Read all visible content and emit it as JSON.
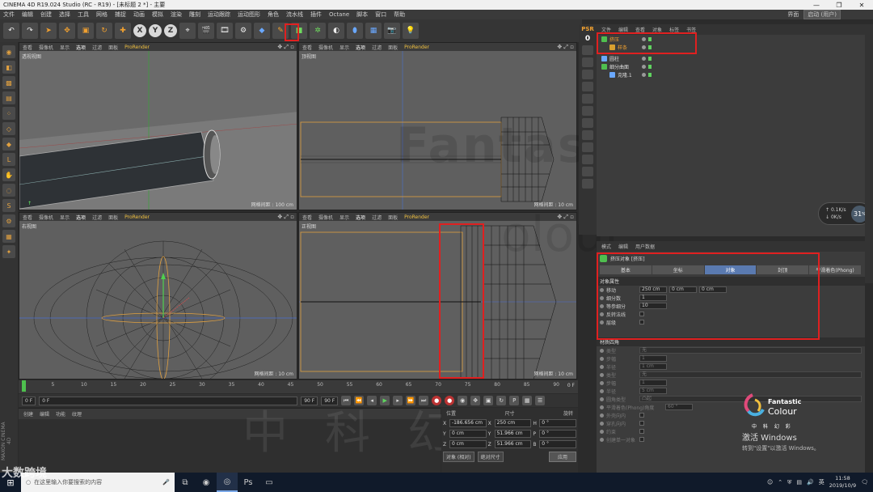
{
  "window": {
    "title": "CINEMA 4D R19.024 Studio (RC - R19) - [未标题 2 *] - 主要",
    "controls": [
      "—",
      "❐",
      "✕"
    ]
  },
  "menu": {
    "items": [
      "文件",
      "编辑",
      "创建",
      "选择",
      "工具",
      "网格",
      "捕捉",
      "动画",
      "模拟",
      "渲染",
      "雕刻",
      "运动跟踪",
      "运动图形",
      "角色",
      "流水线",
      "插件",
      "Octane",
      "脚本",
      "窗口",
      "帮助"
    ],
    "layout_label": "界面",
    "layout_value": "启动 (用户)"
  },
  "toolbar": {
    "axis_x": "X",
    "axis_y": "Y",
    "axis_z": "Z"
  },
  "viewports": {
    "menu": [
      "查看",
      "摄像机",
      "显示",
      "选项",
      "过滤",
      "面板"
    ],
    "prorender": "ProRender",
    "perspective": {
      "label": "透视视图",
      "grid": "网格间距 : 100 cm"
    },
    "top": {
      "label": "顶视图",
      "grid": "网格间距 : 10 cm"
    },
    "right": {
      "label": "右视图",
      "grid": "网格间距 : 10 cm"
    },
    "front": {
      "label": "正视图",
      "grid": "网格间距 : 10 cm"
    }
  },
  "timeline": {
    "ticks": [
      "0",
      "5",
      "10",
      "15",
      "20",
      "25",
      "30",
      "35",
      "40",
      "45",
      "50",
      "55",
      "60",
      "65",
      "70",
      "75",
      "80",
      "85",
      "90"
    ],
    "frame_end_display": "0 F",
    "start": "0 F",
    "min": "0 F",
    "max_field": "90 F",
    "end": "90 F"
  },
  "materials": {
    "menu": [
      "创建",
      "编辑",
      "功能",
      "纹理"
    ]
  },
  "coords": {
    "headers": [
      "位置",
      "尺寸",
      "旋转"
    ],
    "rows": [
      {
        "p_axis": "X",
        "p": "-186.656 cm",
        "s_axis": "X",
        "s": "250 cm",
        "r_axis": "H",
        "r": "0 °"
      },
      {
        "p_axis": "Y",
        "p": "0 cm",
        "s_axis": "Y",
        "s": "51.966 cm",
        "r_axis": "P",
        "r": "0 °"
      },
      {
        "p_axis": "Z",
        "p": "0 cm",
        "s_axis": "Z",
        "s": "51.966 cm",
        "r_axis": "B",
        "r": "0 °"
      }
    ],
    "mode1": "对象 (相对)",
    "mode2": "绝对尺寸",
    "apply": "应用"
  },
  "psr": {
    "label": "PSR",
    "value": "0"
  },
  "object_manager": {
    "tabs": [
      "文件",
      "编辑",
      "查看",
      "对象",
      "标签",
      "书签"
    ],
    "objects": [
      {
        "name": "挤压",
        "color": "#4fbf4f",
        "indent": 0
      },
      {
        "name": "样条",
        "color": "#d8a030",
        "indent": 1
      },
      {
        "name": "圆柱",
        "color": "#6aa8ff",
        "indent": 0
      },
      {
        "name": "细分曲面",
        "color": "#4fbf4f",
        "indent": 0
      },
      {
        "name": "克隆.1",
        "color": "#6aa8ff",
        "indent": 1
      }
    ]
  },
  "hud": {
    "up": "0.1",
    "up_unit": "K/s",
    "down": "0",
    "down_unit": "K/s",
    "percent": "31",
    "percent_unit": "%"
  },
  "attribute_manager": {
    "tabs": [
      "模式",
      "编辑",
      "用户数据"
    ],
    "object_title": "挤压对象 [挤压]",
    "subtabs": [
      "基本",
      "坐标",
      "对象",
      "封顶",
      "平滑着色(Phong)"
    ],
    "active_subtab": 2,
    "section_object": "对象属性",
    "props": [
      {
        "label": "移动",
        "v1": "250 cm",
        "v2": "0 cm",
        "v3": "0 cm"
      },
      {
        "label": "细分数",
        "v1": "1"
      },
      {
        "label": "等参细分",
        "v1": "10"
      },
      {
        "label": "反转法线",
        "check": true
      },
      {
        "label": "层级",
        "check": true
      }
    ],
    "section_material": "材质四角",
    "dim_props": [
      {
        "label": "类型",
        "value": "无"
      },
      {
        "label": "步幅",
        "value": "1"
      },
      {
        "label": "半径",
        "value": "1 cm"
      },
      {
        "label": "类型",
        "value": "无"
      },
      {
        "label": "步幅",
        "value": "1"
      },
      {
        "label": "半径",
        "value": "5 cm"
      },
      {
        "label": "圆角类型",
        "value": "凸起"
      },
      {
        "label": "平滑着色(Phong)角度",
        "value": "60 °"
      },
      {
        "label": "外壳向内",
        "value": ""
      },
      {
        "label": "穿孔向内",
        "value": ""
      },
      {
        "label": "约束",
        "value": ""
      },
      {
        "label": "创建单一对象",
        "value": ""
      }
    ]
  },
  "brand": {
    "logo_word1": "Fantastic",
    "logo_word2": "Colour",
    "logo_cn": "中 科 幻 彩",
    "watermark_main": "Fantastic",
    "watermark_sub": "olour",
    "watermark_cn": "中科幻彩",
    "vertical": "MAXON CINEMA 4D"
  },
  "activation": {
    "line1": "激活 Windows",
    "line2": "转到\"设置\"以激活 Windows。"
  },
  "taskbar": {
    "search_placeholder": "在这里输入你要搜索的内容",
    "time": "11:58",
    "date": "2019/10/9",
    "overlay": "大数跨境"
  }
}
